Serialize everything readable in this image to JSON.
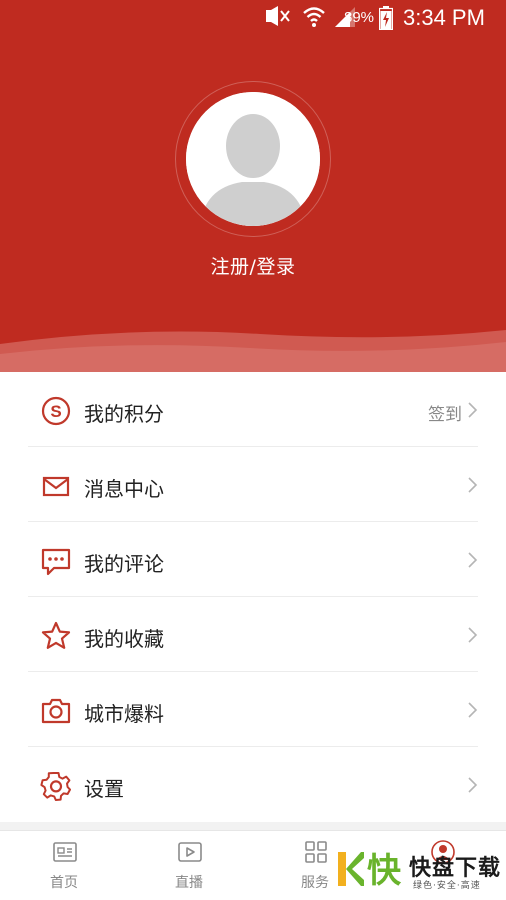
{
  "status_bar": {
    "battery_pct": "89%",
    "time": "3:34 PM",
    "icons": [
      "mute-icon",
      "wifi-icon",
      "signal-icon",
      "battery-charging-icon"
    ]
  },
  "profile": {
    "login_text": "注册/登录",
    "avatar_icon": "default-avatar-icon"
  },
  "menu": {
    "items": [
      {
        "label": "我的积分",
        "icon": "points-icon",
        "extra": "签到"
      },
      {
        "label": "消息中心",
        "icon": "mail-icon",
        "extra": ""
      },
      {
        "label": "我的评论",
        "icon": "comment-icon",
        "extra": ""
      },
      {
        "label": "我的收藏",
        "icon": "star-icon",
        "extra": ""
      },
      {
        "label": "城市爆料",
        "icon": "camera-icon",
        "extra": ""
      },
      {
        "label": "设置",
        "icon": "gear-icon",
        "extra": ""
      }
    ]
  },
  "tabbar": {
    "tabs": [
      {
        "label": "首页",
        "icon": "news-icon"
      },
      {
        "label": "直播",
        "icon": "play-icon"
      },
      {
        "label": "服务",
        "icon": "grid-icon"
      },
      {
        "label": "",
        "icon": "profile-icon"
      }
    ]
  },
  "watermark": {
    "title": "快盘下载",
    "subtitle": "绿色·安全·高速"
  },
  "colors": {
    "brand": "#bf2b20",
    "icon": "#c0392b",
    "text": "#222222",
    "muted": "#888888"
  }
}
